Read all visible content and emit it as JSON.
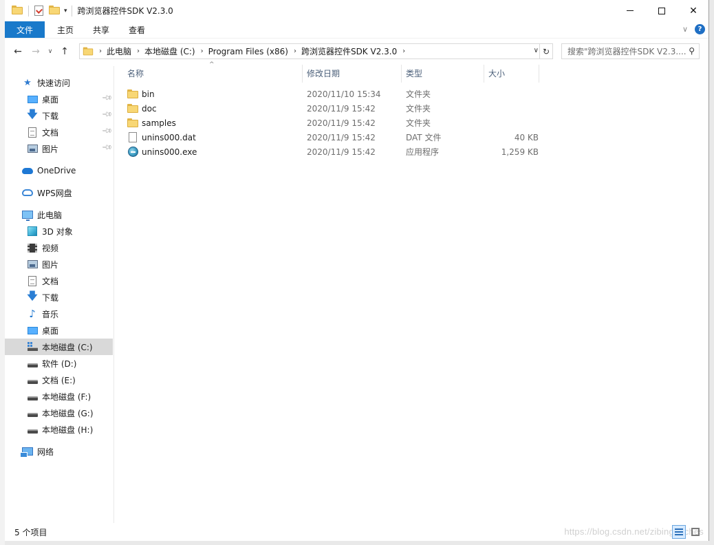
{
  "window": {
    "title": "跨浏览器控件SDK V2.3.0"
  },
  "ribbon": {
    "tabs": [
      {
        "label": "文件"
      },
      {
        "label": "主页"
      },
      {
        "label": "共享"
      },
      {
        "label": "查看"
      }
    ],
    "help_label": "?"
  },
  "address": {
    "breadcrumbs": [
      "此电脑",
      "本地磁盘 (C:)",
      "Program Files (x86)",
      "跨浏览器控件SDK V2.3.0"
    ]
  },
  "search": {
    "placeholder": "搜索\"跨浏览器控件SDK V2.3...."
  },
  "navpane": {
    "quick_access": {
      "label": "快速访问",
      "items": [
        {
          "label": "桌面",
          "icon": "desktop-icon"
        },
        {
          "label": "下载",
          "icon": "download-icon"
        },
        {
          "label": "文档",
          "icon": "document-icon"
        },
        {
          "label": "图片",
          "icon": "picture-icon"
        }
      ]
    },
    "onedrive": {
      "label": "OneDrive"
    },
    "wps": {
      "label": "WPS网盘"
    },
    "this_pc": {
      "label": "此电脑",
      "items": [
        {
          "label": "3D 对象",
          "icon": "3d-objects-icon"
        },
        {
          "label": "视频",
          "icon": "video-icon"
        },
        {
          "label": "图片",
          "icon": "picture-icon"
        },
        {
          "label": "文档",
          "icon": "document-icon"
        },
        {
          "label": "下载",
          "icon": "download-icon"
        },
        {
          "label": "音乐",
          "icon": "music-icon"
        },
        {
          "label": "桌面",
          "icon": "desktop-icon"
        },
        {
          "label": "本地磁盘 (C:)",
          "icon": "windows-drive-icon",
          "selected": true
        },
        {
          "label": "软件 (D:)",
          "icon": "drive-icon"
        },
        {
          "label": "文档 (E:)",
          "icon": "drive-icon"
        },
        {
          "label": "本地磁盘 (F:)",
          "icon": "drive-icon"
        },
        {
          "label": "本地磁盘 (G:)",
          "icon": "drive-icon"
        },
        {
          "label": "本地磁盘 (H:)",
          "icon": "drive-icon"
        }
      ]
    },
    "network": {
      "label": "网络"
    }
  },
  "filelist": {
    "columns": {
      "name": "名称",
      "date": "修改日期",
      "type": "类型",
      "size": "大小"
    },
    "rows": [
      {
        "name": "bin",
        "date": "2020/11/10 15:34",
        "type": "文件夹",
        "size": "",
        "icon": "folder-icon"
      },
      {
        "name": "doc",
        "date": "2020/11/9 15:42",
        "type": "文件夹",
        "size": "",
        "icon": "folder-icon"
      },
      {
        "name": "samples",
        "date": "2020/11/9 15:42",
        "type": "文件夹",
        "size": "",
        "icon": "folder-icon"
      },
      {
        "name": "unins000.dat",
        "date": "2020/11/9 15:42",
        "type": "DAT 文件",
        "size": "40 KB",
        "icon": "file-icon"
      },
      {
        "name": "unins000.exe",
        "date": "2020/11/9 15:42",
        "type": "应用程序",
        "size": "1,259 KB",
        "icon": "exe-icon"
      }
    ]
  },
  "status": {
    "item_count": "5 个项目"
  },
  "watermark": "https://blog.csdn.net/zibingdaches"
}
